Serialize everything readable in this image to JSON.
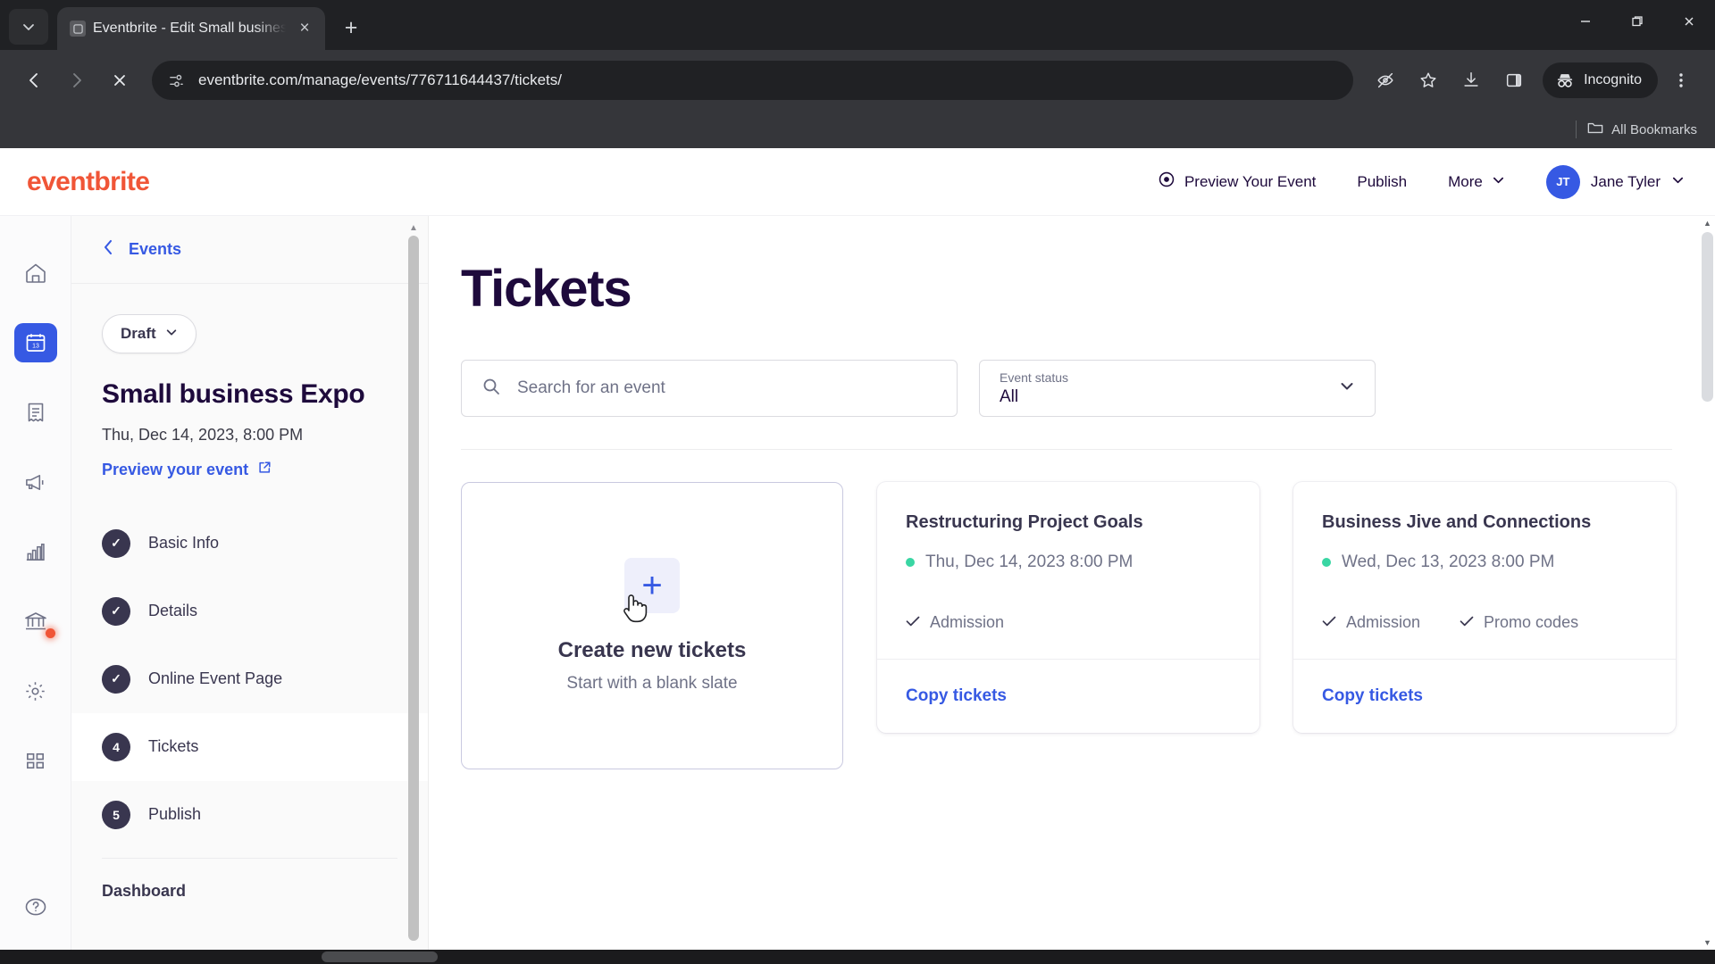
{
  "browser": {
    "tab": {
      "title": "Eventbrite - Edit Small busines",
      "favicon_icon": "page-favicon",
      "close_icon": "×",
      "new_tab_icon": "+",
      "tablist_chevron_icon": "⌄"
    },
    "window_controls": {
      "minimize": "—",
      "maximize": "❐",
      "close": "✕"
    },
    "nav": {
      "back_icon": "←",
      "forward_icon": "→",
      "stop_icon": "✕"
    },
    "omnibox": {
      "url": "eventbrite.com/manage/events/776711644437/tickets/",
      "site_info_icon": "site-settings-icon"
    },
    "toolbar_icons": {
      "hide_password": "eye-slash-icon",
      "bookmark": "star-icon",
      "downloads": "download-icon",
      "side_panel": "side-panel-icon",
      "menu": "three-dot-menu-icon"
    },
    "incognito_label": "Incognito",
    "bookmarks": {
      "all_bookmarks_label": "All Bookmarks",
      "folder_icon": "folder-icon"
    }
  },
  "header": {
    "logo": "eventbrite",
    "preview_event": "Preview Your Event",
    "publish": "Publish",
    "more": "More",
    "more_chevron": "⌄",
    "user_initials": "JT",
    "user_name": "Jane Tyler",
    "user_chevron": "⌄"
  },
  "rail": {
    "items": [
      {
        "name": "home",
        "icon": "home-icon",
        "active": false
      },
      {
        "name": "events",
        "icon": "calendar-icon",
        "active": true
      },
      {
        "name": "orders",
        "icon": "receipt-icon",
        "active": false
      },
      {
        "name": "marketing",
        "icon": "megaphone-icon",
        "active": false
      },
      {
        "name": "reports",
        "icon": "bar-chart-icon",
        "active": false
      },
      {
        "name": "finance",
        "icon": "bank-icon",
        "active": false,
        "badge": true
      },
      {
        "name": "settings",
        "icon": "gear-icon",
        "active": false
      },
      {
        "name": "apps",
        "icon": "grid-icon",
        "active": false
      }
    ],
    "help_icon": "help-circle-icon"
  },
  "panel": {
    "back_label": "Events",
    "back_icon": "‹",
    "status_pill": "Draft",
    "status_chevron": "⌄",
    "event_title": "Small business Expo",
    "event_date": "Thu, Dec 14, 2023, 8:00 PM",
    "preview_link": "Preview your event",
    "preview_link_icon": "external-link-icon",
    "steps": [
      {
        "badge": "✓",
        "label": "Basic Info",
        "active": false
      },
      {
        "badge": "✓",
        "label": "Details",
        "active": false
      },
      {
        "badge": "✓",
        "label": "Online Event Page",
        "active": false
      },
      {
        "badge": "4",
        "label": "Tickets",
        "active": true
      },
      {
        "badge": "5",
        "label": "Publish",
        "active": false
      }
    ],
    "footer_item": "Dashboard"
  },
  "main": {
    "page_title": "Tickets",
    "search": {
      "placeholder": "Search for an event",
      "value": "",
      "icon": "search-icon"
    },
    "event_status": {
      "label": "Event status",
      "value": "All",
      "chevron": "⌄",
      "options": [
        "All"
      ]
    },
    "create_card": {
      "plus_icon": "+",
      "title": "Create new tickets",
      "subtitle": "Start with a blank slate"
    },
    "event_cards": [
      {
        "title": "Restructuring Project Goals",
        "date": "Thu, Dec 14, 2023 8:00 PM",
        "status_dot_color": "#39d6a3",
        "features": [
          "Admission"
        ],
        "feature_icon": "✓",
        "action": "Copy tickets"
      },
      {
        "title": "Business Jive and Connections",
        "date": "Wed, Dec 13, 2023 8:00 PM",
        "status_dot_color": "#39d6a3",
        "features": [
          "Admission",
          "Promo codes"
        ],
        "feature_icon": "✓",
        "action": "Copy tickets"
      }
    ]
  },
  "colors": {
    "brand": "#f05537",
    "accent": "#3659e3",
    "ink": "#1e0a3c",
    "success": "#39d6a3"
  }
}
